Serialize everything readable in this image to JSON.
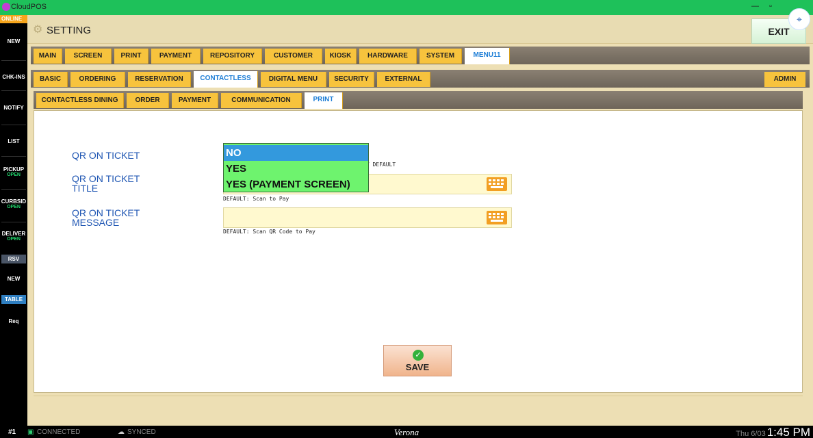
{
  "window": {
    "title": "CloudPOS",
    "minimize": "—",
    "maximize": "▫"
  },
  "sidebar": {
    "online": "ONLINE",
    "items": [
      {
        "label": "NEW"
      },
      {
        "label": "CHK-INS"
      },
      {
        "label": "NOTIFY"
      },
      {
        "label": "LIST"
      },
      {
        "label": "PICKUP",
        "sub": "OPEN"
      },
      {
        "label": "CURBSID",
        "sub": "OPEN"
      },
      {
        "label": "DELIVER",
        "sub": "OPEN"
      },
      {
        "label": "RSV"
      },
      {
        "label": "NEW"
      },
      {
        "label": "TABLE"
      },
      {
        "label": "Req"
      }
    ]
  },
  "header": {
    "title": "SETTING",
    "exit": "EXIT"
  },
  "tabs_main": [
    "MAIN",
    "SCREEN",
    "PRINT",
    "PAYMENT",
    "REPOSITORY",
    "CUSTOMER",
    "KIOSK",
    "HARDWARE",
    "SYSTEM",
    "MENU11"
  ],
  "tabs_sub": [
    "BASIC",
    "ORDERING",
    "RESERVATION",
    "CONTACTLESS",
    "DIGITAL MENU",
    "SECURITY",
    "EXTERNAL"
  ],
  "admin": "ADMIN",
  "tabs_third": [
    "CONTACTLESS DINING",
    "ORDER",
    "PAYMENT",
    "COMMUNICATION",
    "PRINT"
  ],
  "form": {
    "qr_on_ticket": "QR ON TICKET",
    "qr_title": "QR ON TICKET\nTITLE",
    "qr_message": "QR ON TICKET\nMESSAGE",
    "by_default": "BY DEFAULT",
    "title_default": "DEFAULT: Scan to Pay",
    "message_default": "DEFAULT: Scan QR Code to Pay",
    "dropdown": {
      "options": [
        "NO",
        "YES",
        "YES (PAYMENT SCREEN)"
      ],
      "selected": "NO"
    },
    "save": "SAVE"
  },
  "status": {
    "station": "#1",
    "connected": "CONNECTED",
    "synced": "SYNCED",
    "location": "Verona",
    "date": "Thu 6/03",
    "time": "1:45 PM"
  },
  "colors": {
    "accent_tab": "#f7c33d",
    "active_text": "#1c7dd6",
    "dropdown_bg": "#6ef36e",
    "dropdown_sel": "#3399dd"
  }
}
